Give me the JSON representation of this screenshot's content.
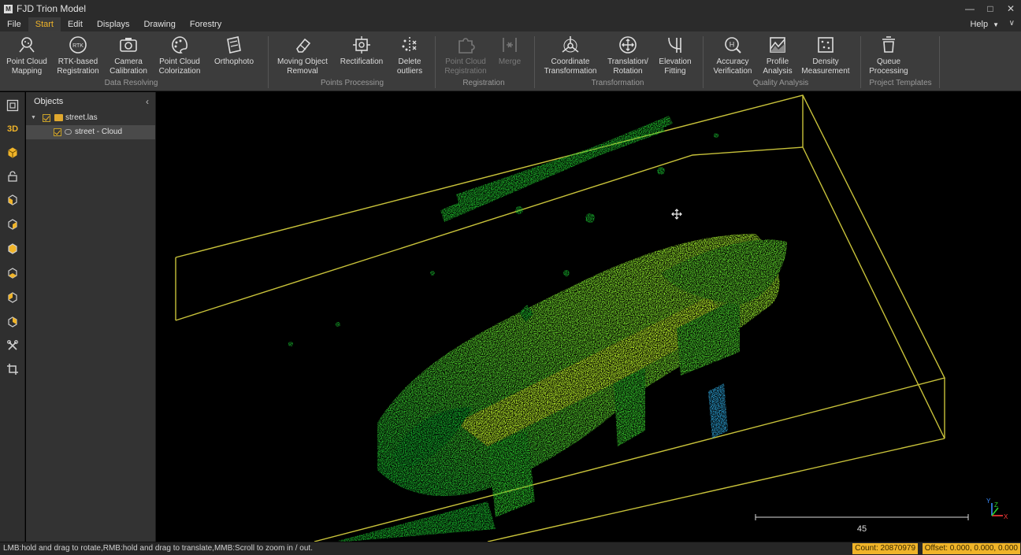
{
  "window": {
    "title": "FJD Trion Model",
    "icon": "app-logo-icon"
  },
  "menu": {
    "items": [
      "File",
      "Start",
      "Edit",
      "Displays",
      "Drawing",
      "Forestry"
    ],
    "active": "Start",
    "help": "Help"
  },
  "ribbon": {
    "buttons": [
      {
        "label": "Point Cloud\nMapping",
        "icon": "point-cloud-mapping-icon"
      },
      {
        "label": "RTK-based\nRegistration",
        "icon": "rtk-icon"
      },
      {
        "label": "Camera\nCalibration",
        "icon": "camera-icon"
      },
      {
        "label": "Point Cloud\nColorization",
        "icon": "palette-icon"
      },
      {
        "label": "Orthophoto",
        "icon": "orthophoto-icon"
      },
      {
        "label": "Moving Object\nRemoval",
        "icon": "eraser-icon"
      },
      {
        "label": "Rectification",
        "icon": "rectification-icon"
      },
      {
        "label": "Delete\noutliers",
        "icon": "delete-outliers-icon"
      },
      {
        "label": "Point Cloud\nRegistration",
        "icon": "puzzle-icon",
        "disabled": true
      },
      {
        "label": "Merge",
        "icon": "merge-icon",
        "disabled": true
      },
      {
        "label": "Coordinate\nTransformation",
        "icon": "coordinate-icon"
      },
      {
        "label": "Translation/\nRotation",
        "icon": "move-rotate-icon"
      },
      {
        "label": "Elevation\nFitting",
        "icon": "elevation-icon"
      },
      {
        "label": "Accuracy\nVerification",
        "icon": "accuracy-icon"
      },
      {
        "label": "Profile\nAnalysis",
        "icon": "profile-icon"
      },
      {
        "label": "Density\nMeasurement",
        "icon": "density-icon"
      },
      {
        "label": "Queue\nProcessing",
        "icon": "queue-icon"
      }
    ],
    "groups": [
      "Data Resolving",
      "Points Processing",
      "Registration",
      "Transformation",
      "Quality Analysis",
      "Project Templates"
    ]
  },
  "left_toolbar": {
    "mode_label": "3D",
    "tools": [
      "fit-view-icon",
      "3d-mode-icon",
      "cube-view-icon",
      "lock-icon",
      "front-view-icon",
      "back-view-icon",
      "top-view-icon",
      "bottom-view-icon",
      "left-view-icon",
      "right-view-icon",
      "measure-tools-icon",
      "crop-icon"
    ]
  },
  "objects_panel": {
    "title": "Objects",
    "tree": [
      {
        "label": "street.las",
        "checked": true,
        "type": "folder"
      },
      {
        "label": "street - Cloud",
        "checked": true,
        "type": "cloud",
        "selected": true
      }
    ]
  },
  "viewport": {
    "scale_label": "45",
    "axis": {
      "x": "X",
      "y": "Y",
      "z": "Z"
    },
    "colors": {
      "box": "#c8c23a",
      "cloud_low": "#0fa82a",
      "cloud_high": "#a8e82a"
    }
  },
  "status": {
    "hint": "LMB:hold and drag to rotate,RMB:hold and drag to translate,MMB:Scroll to zoom in / out.",
    "count": "Count: 20870979",
    "offset": "Offset: 0.000, 0.000, 0.000"
  }
}
